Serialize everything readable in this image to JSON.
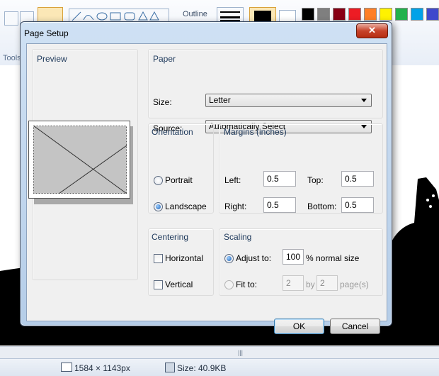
{
  "app": {
    "ribbon": {
      "outline_label": "Outline",
      "tools_label": "Tools",
      "colors": [
        "#000000",
        "#7f7f7f",
        "#880015",
        "#ed1c24",
        "#ff7f27",
        "#fff200",
        "#22b14c",
        "#00a2e8",
        "#3f48cc",
        "#a349a4"
      ]
    },
    "status": {
      "dimensions": "1584 × 1143px",
      "size": "Size: 40.9KB"
    }
  },
  "dialog": {
    "title": "Page Setup",
    "close_glyph": "✕",
    "preview": {
      "title": "Preview"
    },
    "paper": {
      "title": "Paper",
      "size_label": "Size:",
      "size_value": "Letter",
      "source_label": "Source:",
      "source_value": "Automatically Select"
    },
    "orientation": {
      "title": "Orientation",
      "portrait_label": "Portrait",
      "landscape_label": "Landscape",
      "selected": "Landscape"
    },
    "margins": {
      "title": "Margins (inches)",
      "left_label": "Left:",
      "left_value": "0.5",
      "top_label": "Top:",
      "top_value": "0.5",
      "right_label": "Right:",
      "right_value": "0.5",
      "bottom_label": "Bottom:",
      "bottom_value": "0.5"
    },
    "centering": {
      "title": "Centering",
      "horizontal_label": "Horizontal",
      "vertical_label": "Vertical"
    },
    "scaling": {
      "title": "Scaling",
      "adjust_label": "Adjust to:",
      "adjust_value": "100",
      "adjust_suffix": "% normal size",
      "fit_label": "Fit to:",
      "fit_pages_wide": "2",
      "by_label": "by",
      "fit_pages_tall": "2",
      "pages_suffix": "page(s)"
    },
    "ok_label": "OK",
    "cancel_label": "Cancel"
  }
}
